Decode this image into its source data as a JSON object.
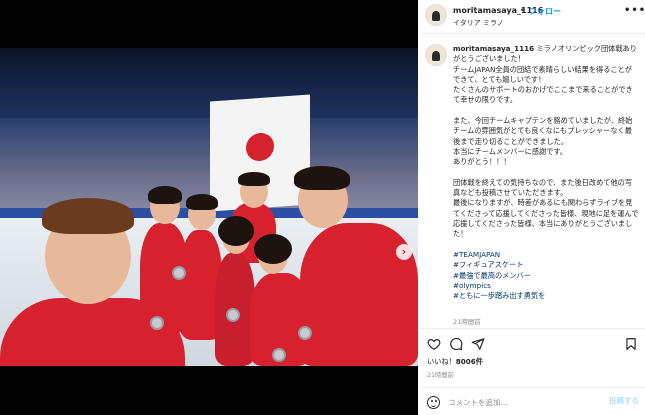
{
  "post": {
    "username": "moritamasaya_1116",
    "separator": "•",
    "follow_label": "フォロー",
    "location": "イタリア ミラノ",
    "more_label": "•••"
  },
  "caption": {
    "username": "moritamasaya_1116",
    "lines": [
      "ミラノオリンピック団体戦ありがとうございました！",
      "チームJAPAN全員の団結で素晴らしい結果を得ることができて、とても嬉しいです！",
      "たくさんのサポートのおかげでここまで来ることができて幸せの限りです。",
      "",
      "また、今回チームキャプテンを務めていましたが、終始チームの雰囲気がとても良くなにもプレッシャーなく最後まで走り切ることができました。",
      "本当にチームメンバーに感謝です。",
      "ありがとう！！！",
      "",
      "団体戦を終えての気持ちなので、また後日改めて他の写真なども投稿させていただきます。",
      "最後になりますが、時差があるにも関わらずライブを見てくださって応援してくださった皆様、現地に足を運んで応援してくださった皆様、本当にありがとうございました！"
    ],
    "hashtags": [
      "#TEAMJAPAN",
      "#フィギュアスケート",
      "#最強で最高のメンバー",
      "#olympics",
      "#ともに一歩踏み出す勇気を"
    ],
    "time": "21時間前"
  },
  "actions": {
    "like_icon": "heart-icon",
    "comment_icon": "comment-icon",
    "share_icon": "share-icon",
    "save_icon": "bookmark-icon"
  },
  "likes": {
    "label": "いいね！",
    "count": "8006件"
  },
  "posted_ago": "21時間前",
  "comment_box": {
    "placeholder": "コメントを追加...",
    "post_label": "投稿する"
  },
  "colors": {
    "accent": "#0095f6",
    "post_disabled": "#b2dffc"
  }
}
